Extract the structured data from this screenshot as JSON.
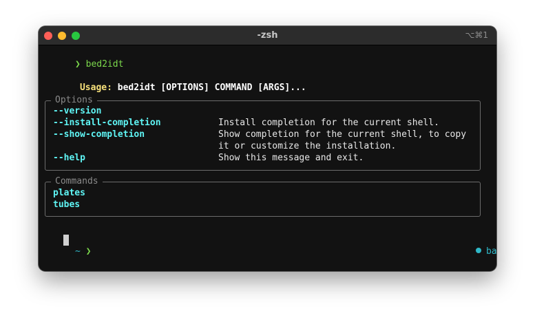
{
  "window": {
    "title": "-zsh",
    "shortcut": "⌥⌘1"
  },
  "terminal": {
    "command_prompt": "❯",
    "command": "bed2idt",
    "usage_label": "Usage:",
    "usage_text": "bed2idt [OPTIONS] COMMAND [ARGS]...",
    "options_title": "Options",
    "options": [
      {
        "flag": "--version",
        "description": ""
      },
      {
        "flag": "--install-completion",
        "description": "Install completion for the current shell."
      },
      {
        "flag": "--show-completion",
        "description": "Show completion for the current shell, to copy"
      },
      {
        "flag": "",
        "description": "it or customize the installation."
      },
      {
        "flag": "--help",
        "description": "Show this message and exit."
      }
    ],
    "commands_title": "Commands",
    "commands": [
      "plates",
      "tubes"
    ],
    "final_prompt_dir": "~",
    "final_prompt_arrow": "❯",
    "env_name": "base"
  },
  "colors": {
    "window_bg": "#121212",
    "titlebar_bg": "#2c2c2c",
    "prompt_green": "#7cd94c",
    "usage_yellow": "#f7e17b",
    "flag_cyan": "#5ff5f5",
    "env_cyan": "#2fb8c8"
  }
}
